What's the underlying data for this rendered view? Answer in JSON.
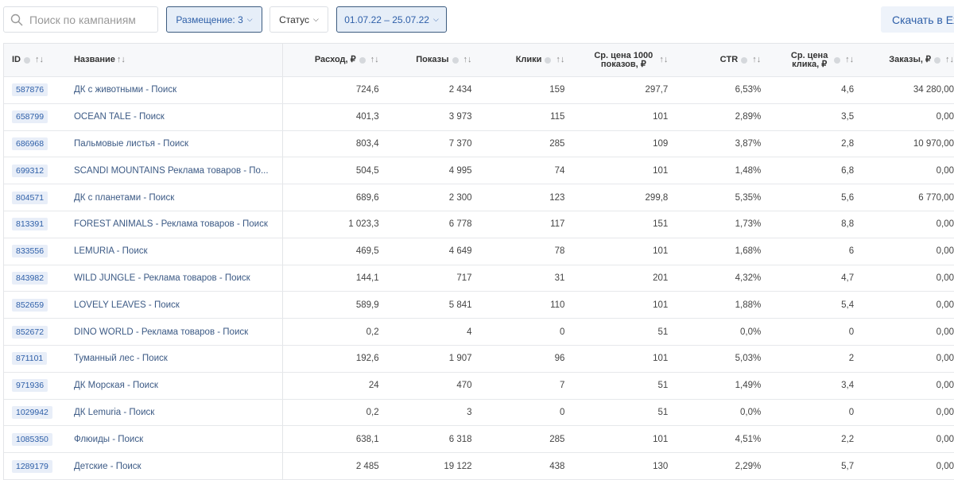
{
  "toolbar": {
    "search_placeholder": "Поиск по кампаниям",
    "placement": "Размещение: 3",
    "status": "Статус",
    "date_range": "01.07.22 – 25.07.22",
    "excel": "Скачать в Excel"
  },
  "headers": {
    "id": "ID",
    "name": "Название",
    "spend": "Расход, ₽",
    "views": "Показы",
    "clicks": "Клики",
    "cpm": "Ср. цена 1000 показов, ₽",
    "ctr": "CTR",
    "cpc": "Ср. цена клика, ₽",
    "orders": "Заказы, ₽"
  },
  "rows": [
    [
      "587876",
      "ДК с животными - Поиск",
      "724,6",
      "2 434",
      "159",
      "297,7",
      "6,53%",
      "4,6",
      "34 280,00"
    ],
    [
      "658799",
      "OCEAN TALE - Поиск",
      "401,3",
      "3 973",
      "115",
      "101",
      "2,89%",
      "3,5",
      "0,00"
    ],
    [
      "686968",
      "Пальмовые листья - Поиск",
      "803,4",
      "7 370",
      "285",
      "109",
      "3,87%",
      "2,8",
      "10 970,00"
    ],
    [
      "699312",
      "SCANDI MOUNTAINS Реклама товаров - По...",
      "504,5",
      "4 995",
      "74",
      "101",
      "1,48%",
      "6,8",
      "0,00"
    ],
    [
      "804571",
      "ДК с планетами - Поиск",
      "689,6",
      "2 300",
      "123",
      "299,8",
      "5,35%",
      "5,6",
      "6 770,00"
    ],
    [
      "813391",
      "FOREST ANIMALS - Реклама товаров - Поиск",
      "1 023,3",
      "6 778",
      "117",
      "151",
      "1,73%",
      "8,8",
      "0,00"
    ],
    [
      "833556",
      "LEMURIA - Поиск",
      "469,5",
      "4 649",
      "78",
      "101",
      "1,68%",
      "6",
      "0,00"
    ],
    [
      "843982",
      "WILD JUNGLE - Реклама товаров - Поиск",
      "144,1",
      "717",
      "31",
      "201",
      "4,32%",
      "4,7",
      "0,00"
    ],
    [
      "852659",
      "LOVELY LEAVES - Поиск",
      "589,9",
      "5 841",
      "110",
      "101",
      "1,88%",
      "5,4",
      "0,00"
    ],
    [
      "852672",
      "DINO WORLD - Реклама товаров - Поиск",
      "0,2",
      "4",
      "0",
      "51",
      "0,0%",
      "0",
      "0,00"
    ],
    [
      "871101",
      "Туманный лес - Поиск",
      "192,6",
      "1 907",
      "96",
      "101",
      "5,03%",
      "2",
      "0,00"
    ],
    [
      "971936",
      "ДК Морская - Поиск",
      "24",
      "470",
      "7",
      "51",
      "1,49%",
      "3,4",
      "0,00"
    ],
    [
      "1029942",
      "ДК Lemuria - Поиск",
      "0,2",
      "3",
      "0",
      "51",
      "0,0%",
      "0",
      "0,00"
    ],
    [
      "1085350",
      "Флюиды - Поиск",
      "638,1",
      "6 318",
      "285",
      "101",
      "4,51%",
      "2,2",
      "0,00"
    ],
    [
      "1289179",
      "Детские - Поиск",
      "2 485",
      "19 122",
      "438",
      "130",
      "2,29%",
      "5,7",
      "0,00"
    ]
  ]
}
